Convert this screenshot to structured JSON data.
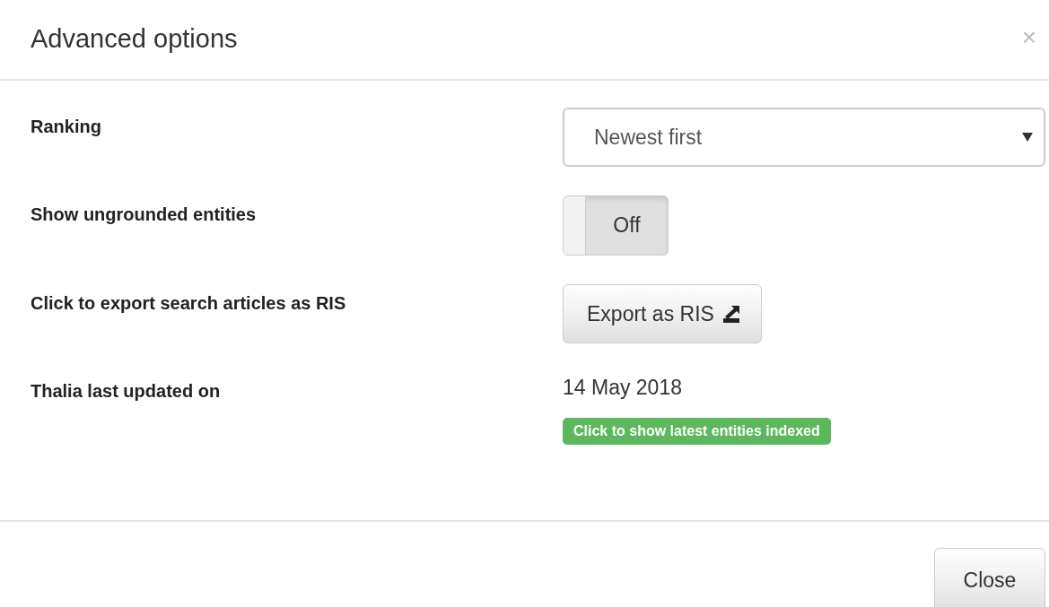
{
  "dialog": {
    "title": "Advanced options",
    "close_icon": "×"
  },
  "rows": [
    {
      "kind": "select",
      "label": "Ranking",
      "value": "Newest first"
    },
    {
      "kind": "toggle",
      "label": "Show ungrounded entities",
      "on": false,
      "value": "Off"
    },
    {
      "kind": "button",
      "label": "Click to export search articles as RIS",
      "value": "Export as RIS"
    },
    {
      "kind": "text",
      "label": "Thalia last updated on",
      "value": "14 May 2018",
      "badge": "Click to show latest entities indexed"
    }
  ],
  "footer": {
    "button": "Close"
  }
}
